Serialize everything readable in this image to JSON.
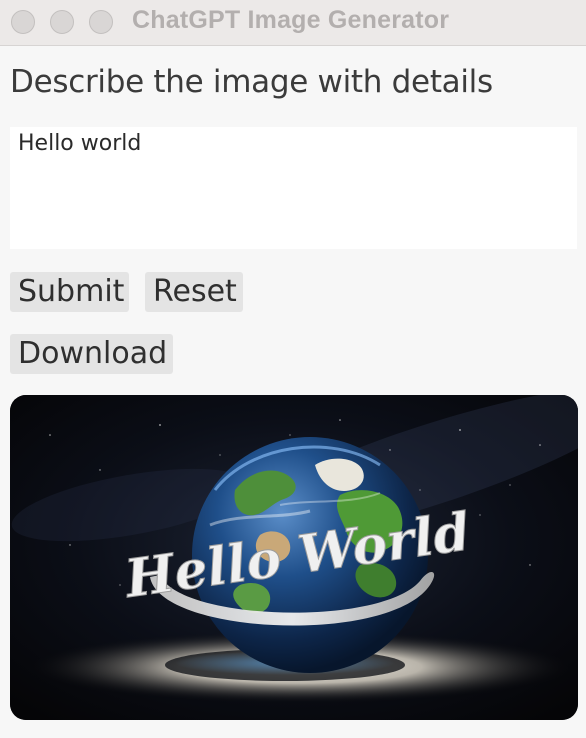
{
  "window": {
    "title": "ChatGPT Image Generator",
    "controls": [
      "close",
      "minimize",
      "maximize"
    ]
  },
  "form": {
    "prompt_label": "Describe the image with details",
    "prompt_value": "Hello world",
    "submit_label": "Submit",
    "reset_label": "Reset",
    "download_label": "Download"
  },
  "image": {
    "text": "Hello World",
    "icon": "generated-image-globe"
  },
  "colors": {
    "titlebar": "#ece9e8",
    "background": "#f7f7f7",
    "button": "#e4e4e4",
    "image_background": "#0b0c10"
  }
}
